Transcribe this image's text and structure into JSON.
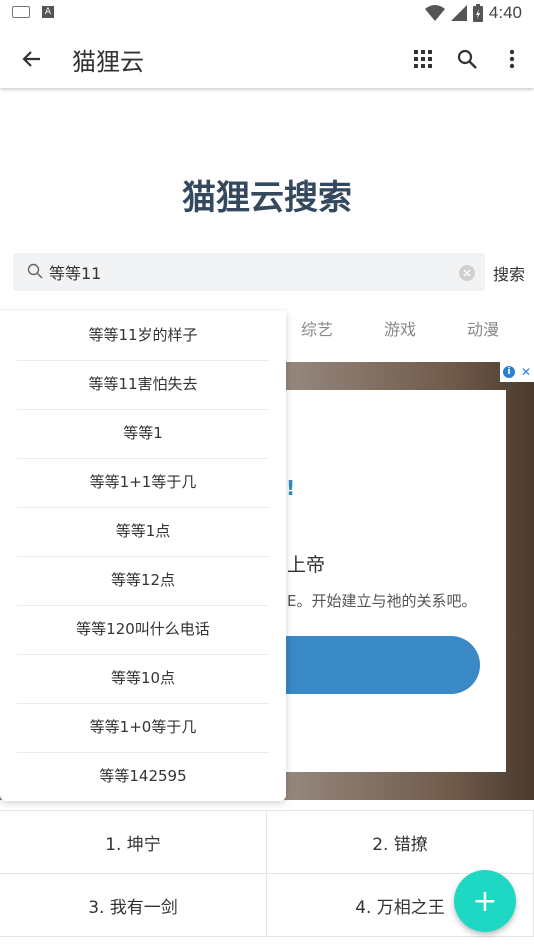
{
  "status_bar": {
    "time": "4:40",
    "a_icon_letter": "A"
  },
  "app_bar": {
    "title": "猫狸云"
  },
  "heading": "猫狸云搜索",
  "search": {
    "value": "等等11",
    "button_label": "搜索"
  },
  "tabs": [
    "综艺",
    "游戏",
    "动漫"
  ],
  "suggestions": [
    "等等11岁的样子",
    "等等11害怕失去",
    "等等1",
    "等等1+1等于几",
    "等等1点",
    "等等12点",
    "等等120叫什么电话",
    "等等10点",
    "等等1+0等于几",
    "等等142595"
  ],
  "ad": {
    "mark": "!",
    "title": "上帝",
    "description": "E。开始建立与祂的关系吧。",
    "info_letter": "i",
    "close_glyph": "✕"
  },
  "rankings": [
    "1. 坤宁",
    "2. 错撩",
    "3. 我有一剑",
    "4. 万相之王"
  ],
  "fab_label": "+",
  "colors": {
    "heading": "#34495e",
    "fab": "#1fd8c3",
    "ad_button": "#3889c5"
  }
}
